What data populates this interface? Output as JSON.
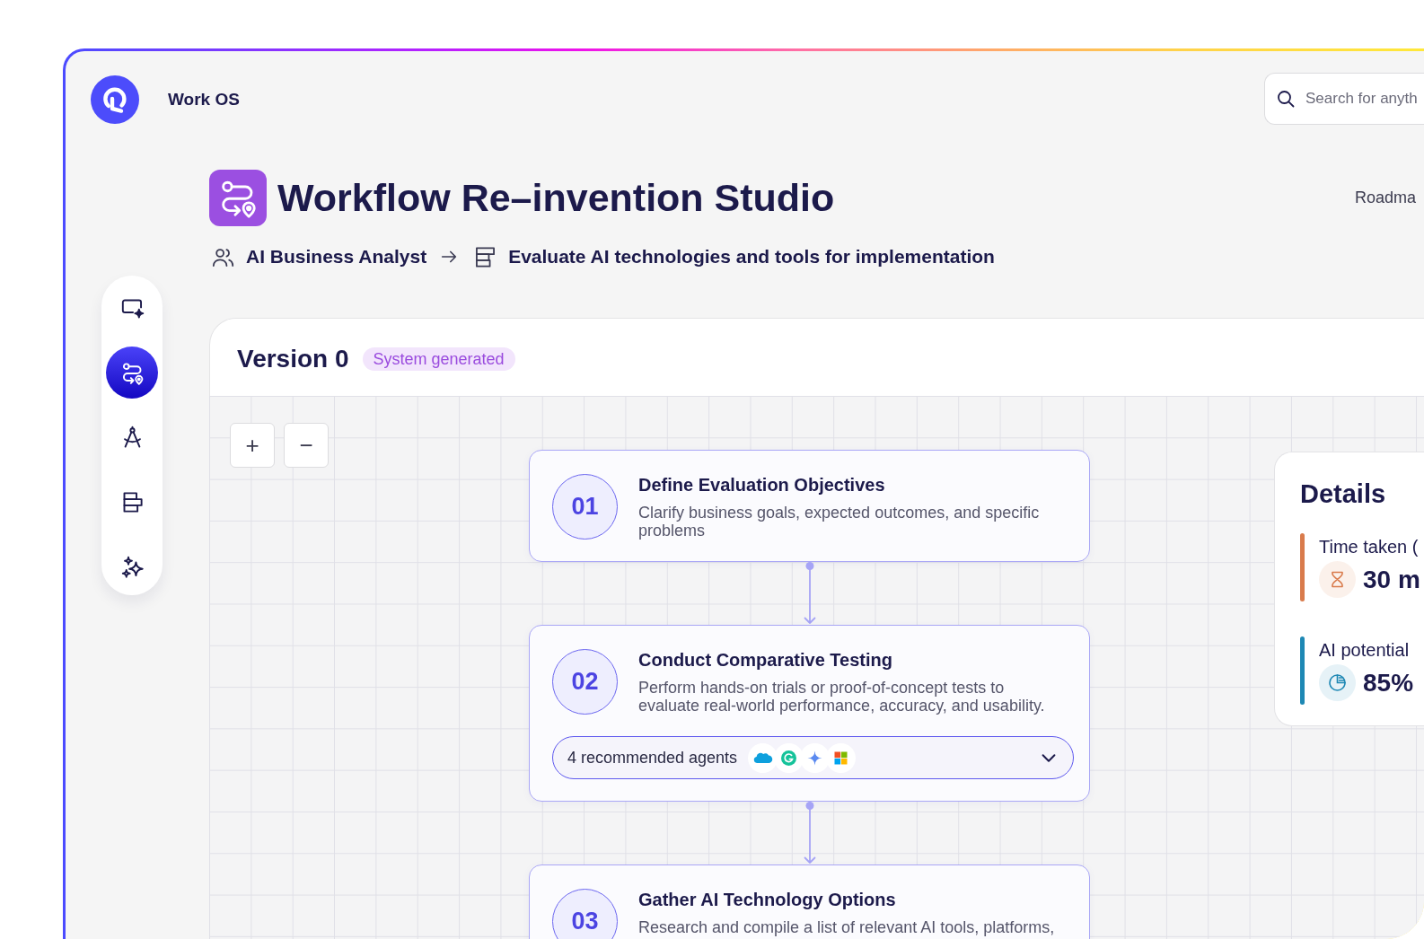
{
  "header": {
    "app_name": "Work OS",
    "search": {
      "placeholder": "Search for anyth"
    }
  },
  "sidebar": {
    "items": [
      {
        "kind": "screen",
        "selected": false
      },
      {
        "kind": "route",
        "selected": true
      },
      {
        "kind": "compass",
        "selected": false
      },
      {
        "kind": "stack",
        "selected": false
      },
      {
        "kind": "sparkles",
        "selected": false
      }
    ]
  },
  "page": {
    "title": "Workflow Re–invention Studio",
    "link": "Roadma",
    "breadcrumb": [
      {
        "kind": "role",
        "label": "AI Business Analyst"
      },
      {
        "kind": "task",
        "label": "Evaluate AI technologies and tools for implementation"
      }
    ]
  },
  "version": {
    "title": "Version 0",
    "badge": "System generated"
  },
  "canvas": {
    "zoom_buttons": [
      "+",
      "−"
    ],
    "steps": [
      {
        "number": "01",
        "title": "Define Evaluation Objectives",
        "description": "Clarify business goals, expected outcomes, and specific problems"
      },
      {
        "number": "02",
        "title": "Conduct Comparative Testing",
        "description": "Perform hands-on trials or proof-of-concept tests to evaluate real-world performance, accuracy, and usability.",
        "agents": {
          "label": "4 recommended agents",
          "expanded": false
        }
      },
      {
        "number": "03",
        "title": "Gather AI Technology Options",
        "description": "Research and compile a list of relevant AI tools, platforms,"
      }
    ],
    "details": {
      "title": "Details",
      "metrics": [
        {
          "kind": "time",
          "label": "Time taken (",
          "value": "30 m",
          "color": "#d97b4c"
        },
        {
          "kind": "potential",
          "label": "AI potential",
          "value": "85%",
          "color": "#1e88b4"
        }
      ]
    }
  }
}
